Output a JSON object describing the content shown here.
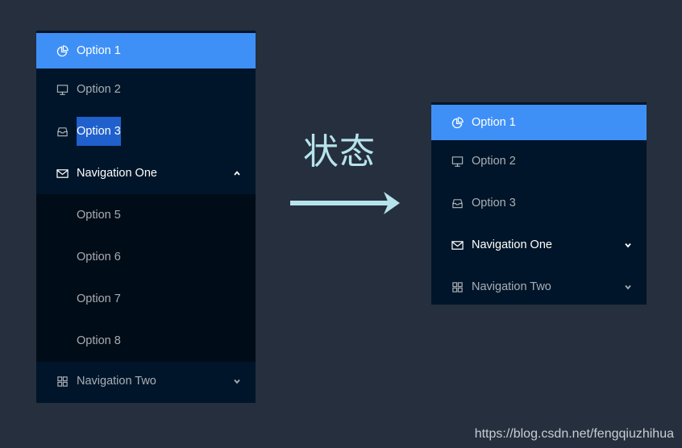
{
  "left_menu": {
    "items": [
      {
        "label": "Option 1",
        "icon": "pie-chart-icon",
        "state": "selected"
      },
      {
        "label": "Option 2",
        "icon": "desktop-icon"
      },
      {
        "label": "Option 3",
        "icon": "inbox-icon",
        "state": "text-highlighted"
      }
    ],
    "submenus": [
      {
        "label": "Navigation One",
        "icon": "mail-icon",
        "expanded": true,
        "children": [
          "Option 5",
          "Option 6",
          "Option 7",
          "Option 8"
        ]
      },
      {
        "label": "Navigation Two",
        "icon": "appstore-icon",
        "expanded": false
      }
    ]
  },
  "transition": {
    "label": "状态",
    "arrow": "right-arrow-icon"
  },
  "right_menu": {
    "items": [
      {
        "label": "Option 1",
        "icon": "pie-chart-icon",
        "state": "selected"
      },
      {
        "label": "Option 2",
        "icon": "desktop-icon"
      },
      {
        "label": "Option 3",
        "icon": "inbox-icon"
      }
    ],
    "submenus": [
      {
        "label": "Navigation One",
        "icon": "mail-icon",
        "expanded": false
      },
      {
        "label": "Navigation Two",
        "icon": "appstore-icon",
        "expanded": false
      }
    ]
  },
  "watermark": "https://blog.csdn.net/fengqiuzhihua",
  "colors": {
    "background": "#252f3d",
    "menu_dark": "#001529",
    "submenu_dark": "#000c17",
    "selected": "#3f90f6",
    "text_highlight": "#2060cc",
    "status_text": "#b7e3ec"
  }
}
